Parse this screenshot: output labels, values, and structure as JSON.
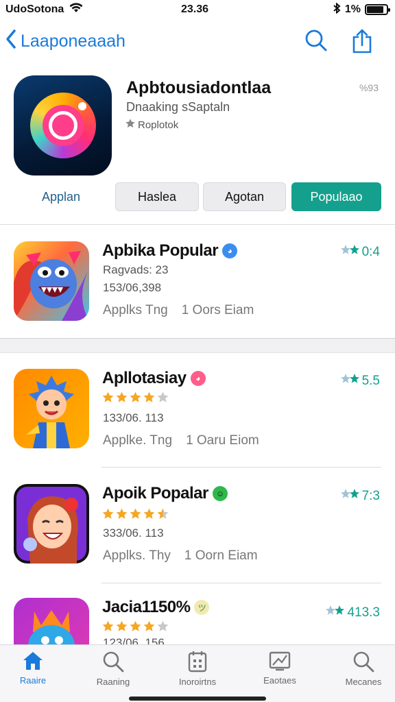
{
  "status_bar": {
    "carrier": "UdoSotona",
    "time": "23.36",
    "battery_text": "1%",
    "battery_level": 0.85
  },
  "nav": {
    "back_label": "Laaponeaaah",
    "icons": [
      "chevron-left-icon",
      "search-icon",
      "share-icon"
    ]
  },
  "header": {
    "title": "Apbtousiadontlaa",
    "subtitle": "Dnaaking sSaptaln",
    "category": "Roplotok",
    "corner": "%93"
  },
  "tabs": [
    "Applan",
    "Haslea",
    "Agotan",
    "Populaao"
  ],
  "list": [
    {
      "title": "Apbika Popular",
      "meta1": "Ragvads: 23",
      "meta2": "153/06,398",
      "foot_left": "Applks Tng",
      "foot_right": "1 Oors Eiam",
      "score": "0:4",
      "rating": null
    },
    {
      "title": "Apllotasiay",
      "meta1": "",
      "meta2": "133/06. 113",
      "foot_left": "Applke. Tng",
      "foot_right": "1 Oaru Eiom",
      "score": "5.5",
      "rating": 4
    },
    {
      "title": "Apoik Popalar",
      "meta1": "",
      "meta2": "333/06. 113",
      "foot_left": "Applks. Thy",
      "foot_right": "1 Oorn Eiam",
      "score": "7:3",
      "rating": 4.5
    },
    {
      "title": "Jacia1150%",
      "meta1": "",
      "meta2": "123/06. 156",
      "foot_left": "",
      "foot_right": "",
      "score": "413.3",
      "rating": 4
    }
  ],
  "bottom_tabs": [
    {
      "label": "Raaire",
      "icon": "home-icon",
      "active": true
    },
    {
      "label": "Raaning",
      "icon": "search-icon",
      "active": false
    },
    {
      "label": "Inoroirtns",
      "icon": "calendar-icon",
      "active": false
    },
    {
      "label": "Eaotaes",
      "icon": "image-icon",
      "active": false
    },
    {
      "label": "Mecanes",
      "icon": "search-icon",
      "active": false
    }
  ],
  "colors": {
    "accent": "#1a7ad9",
    "teal": "#14a08d",
    "star": "#f5a623"
  }
}
